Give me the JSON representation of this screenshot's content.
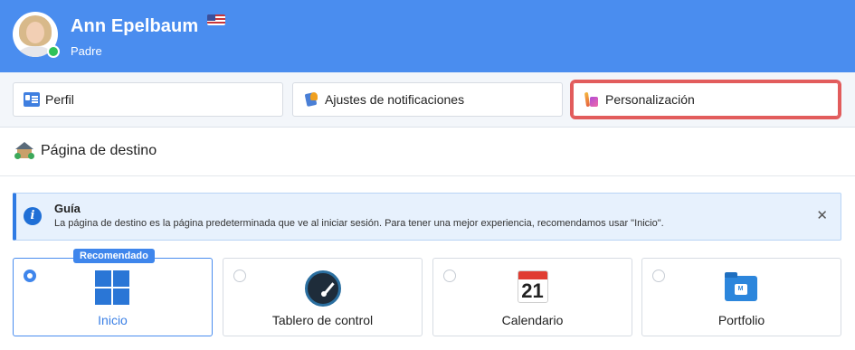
{
  "user": {
    "name": "Ann Epelbaum",
    "role": "Padre",
    "status": "online",
    "flag_icon": "us-flag-icon"
  },
  "tabs": [
    {
      "label": "Perfil",
      "icon": "id-card-icon",
      "active": false
    },
    {
      "label": "Ajustes de notificaciones",
      "icon": "notification-settings-icon",
      "active": false
    },
    {
      "label": "Personalización",
      "icon": "paint-icon",
      "active": true
    }
  ],
  "section": {
    "title": "Página de destino",
    "icon": "house-icon"
  },
  "guide": {
    "title": "Guía",
    "text": "La página de destino es la página predeterminada que ve al iniciar sesión. Para tener una mejor experiencia, recomendamos usar \"Inicio\".",
    "close_glyph": "✕"
  },
  "landing_options": [
    {
      "label": "Inicio",
      "icon": "windows-grid-icon",
      "selected": true,
      "badge": "Recomendado"
    },
    {
      "label": "Tablero de control",
      "icon": "speedometer-icon",
      "selected": false
    },
    {
      "label": "Calendario",
      "icon": "calendar-icon",
      "selected": false,
      "calendar_day": "21"
    },
    {
      "label": "Portfolio",
      "icon": "portfolio-folder-icon",
      "selected": false
    }
  ],
  "colors": {
    "header_bg": "#4a8def",
    "accent": "#3f86ec",
    "active_tab_outline": "#e25c5c",
    "online": "#2ec25a",
    "guide_bg": "#e7f1fd"
  }
}
